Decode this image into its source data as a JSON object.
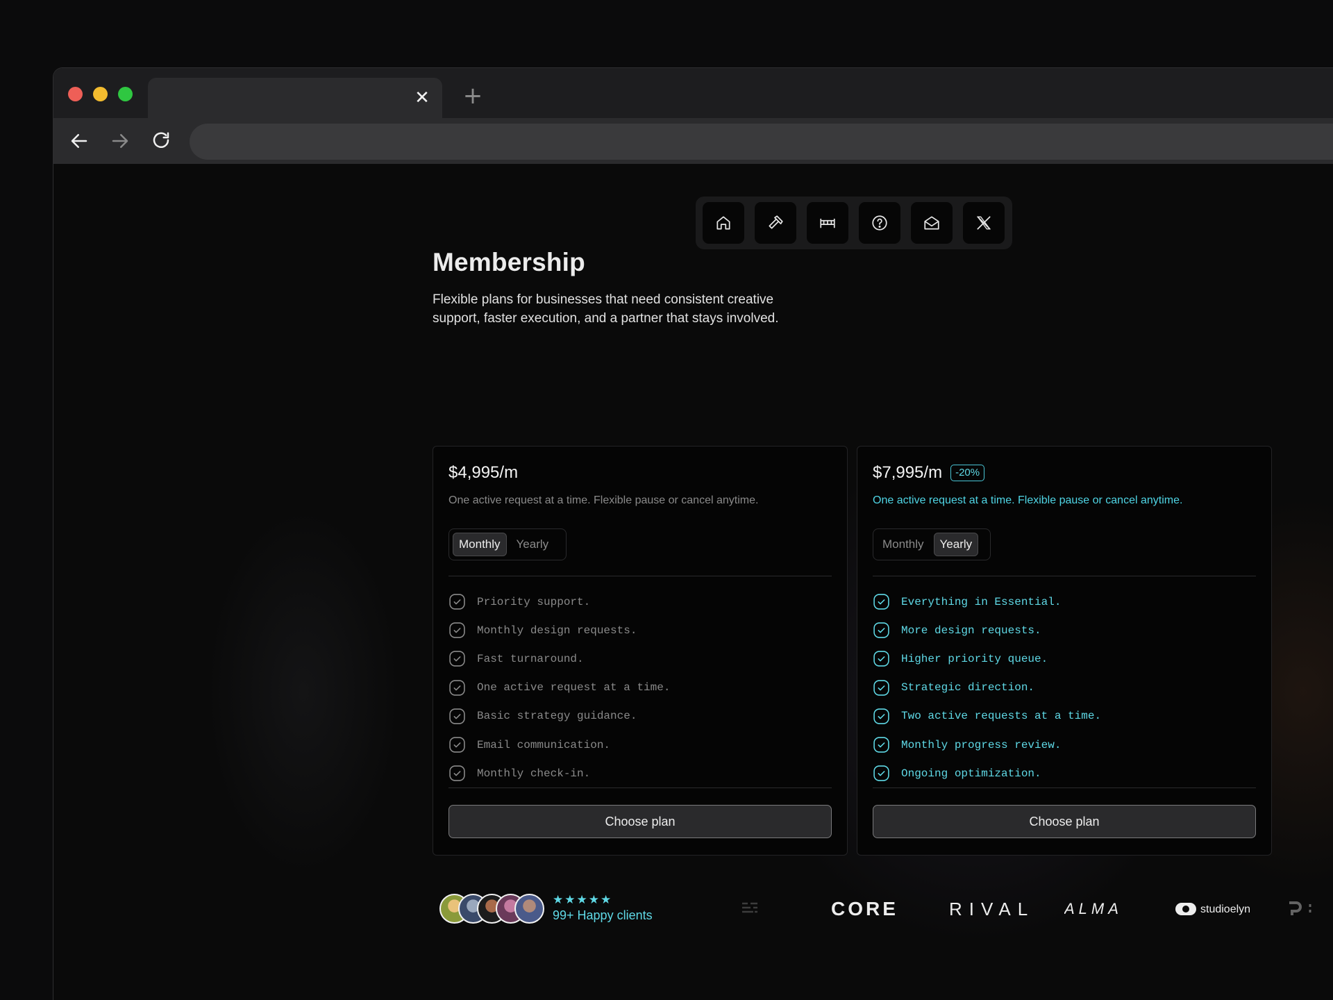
{
  "browser": {
    "tab_close_glyph": "✕",
    "new_tab_glyph": "+"
  },
  "nav": {
    "icons": [
      "home-icon",
      "hammer-icon",
      "bed-icon",
      "help-icon",
      "mail-icon",
      "x-logo-icon"
    ]
  },
  "header": {
    "title": "Membership",
    "subtitle": "Flexible plans for businesses that need consistent creative support, faster execution, and a partner that stays involved."
  },
  "plans": [
    {
      "price": "$4,995/m",
      "badge": "",
      "description": "One active request at a time. Flexible pause or cancel anytime.",
      "billing_options": [
        "Monthly",
        "Yearly"
      ],
      "selected_billing": "Monthly",
      "features": [
        "Priority support.",
        "Monthly design requests.",
        "Fast turnaround.",
        "One active request at a time.",
        "Basic strategy guidance.",
        "Email communication.",
        "Monthly check-in."
      ],
      "cta": "Choose plan"
    },
    {
      "price": "$7,995/m",
      "badge": "-20%",
      "description": "One active request at a time. Flexible pause or cancel anytime.",
      "billing_options": [
        "Monthly",
        "Yearly"
      ],
      "selected_billing": "Yearly",
      "features": [
        "Everything in Essential.",
        "More design requests.",
        "Higher priority queue.",
        "Strategic direction.",
        "Two active requests at a time.",
        "Monthly progress review.",
        "Ongoing optimization."
      ],
      "cta": "Choose plan"
    }
  ],
  "social_proof": {
    "stars": "★★★★★",
    "rating_count": 5,
    "label": "99+ Happy clients"
  },
  "logos": {
    "core": "CORE",
    "rival": "RIVAL",
    "alma": "ALMA",
    "studio": "studioelyn"
  },
  "colors": {
    "accent": "#5fd9e6",
    "muted": "#8a8a8a",
    "background": "#0a0a0a"
  }
}
